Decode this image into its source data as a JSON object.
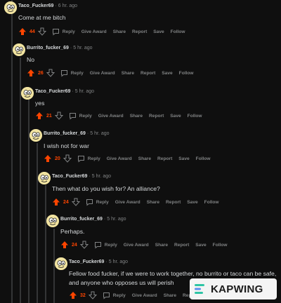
{
  "colors": {
    "background": "#0f0f0f",
    "upvote_active": "#ff4500",
    "muted_text": "#818384",
    "text": "#d7dadc"
  },
  "actions": {
    "reply": "Reply",
    "give_award": "Give Award",
    "share": "Share",
    "report": "Report",
    "save": "Save",
    "follow": "Follow"
  },
  "comments": [
    {
      "author": "Taco_Fucker69",
      "time": "6 hr. ago",
      "body": "Come at me bitch",
      "score": "44",
      "upvoted": true
    },
    {
      "author": "Burrito_fucker_69",
      "time": "5 hr. ago",
      "body": "No",
      "score": "26",
      "upvoted": true
    },
    {
      "author": "Taco_Fucker69",
      "time": "5 hr. ago",
      "body": "yes",
      "score": "21",
      "upvoted": true
    },
    {
      "author": "Burrito_fucker_69",
      "time": "5 hr. ago",
      "body": "I wish not for war",
      "score": "20",
      "upvoted": true
    },
    {
      "author": "Taco_Fucker69",
      "time": "5 hr. ago",
      "body": "Then what do you wish for? An alliance?",
      "score": "24",
      "upvoted": true
    },
    {
      "author": "Burrito_fucker_69",
      "time": "5 hr. ago",
      "body": "Perhaps.",
      "score": "24",
      "upvoted": true
    },
    {
      "author": "Taco_Fucker69",
      "time": "5 hr. ago",
      "body": "Fellow food fucker, if we were to work together, no burrito or taco can be safe, and anyone who opposes us will perish",
      "score": "32",
      "upvoted": true
    }
  ],
  "watermark": {
    "label": "KAPWING"
  }
}
